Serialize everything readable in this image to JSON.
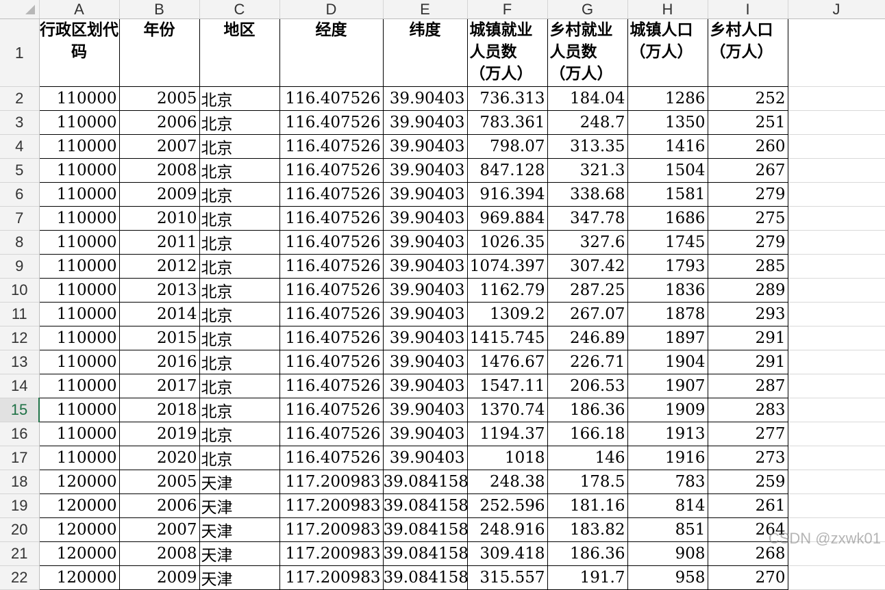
{
  "columns": [
    "A",
    "B",
    "C",
    "D",
    "E",
    "F",
    "G",
    "H",
    "I",
    "J"
  ],
  "header_row": {
    "row_number": "1",
    "cells": [
      "行政区划代码",
      "年份",
      "地区",
      "经度",
      "纬度",
      "城镇就业人员数（万人）",
      "乡村就业人员数（万人）",
      "城镇人口（万人）",
      "乡村人口（万人）",
      ""
    ]
  },
  "active_row": "15",
  "rows": [
    {
      "n": "2",
      "v": [
        "110000",
        "2005",
        "北京",
        "116.407526",
        "39.90403",
        "736.313",
        "184.04",
        "1286",
        "252"
      ]
    },
    {
      "n": "3",
      "v": [
        "110000",
        "2006",
        "北京",
        "116.407526",
        "39.90403",
        "783.361",
        "248.7",
        "1350",
        "251"
      ]
    },
    {
      "n": "4",
      "v": [
        "110000",
        "2007",
        "北京",
        "116.407526",
        "39.90403",
        "798.07",
        "313.35",
        "1416",
        "260"
      ]
    },
    {
      "n": "5",
      "v": [
        "110000",
        "2008",
        "北京",
        "116.407526",
        "39.90403",
        "847.128",
        "321.3",
        "1504",
        "267"
      ]
    },
    {
      "n": "6",
      "v": [
        "110000",
        "2009",
        "北京",
        "116.407526",
        "39.90403",
        "916.394",
        "338.68",
        "1581",
        "279"
      ]
    },
    {
      "n": "7",
      "v": [
        "110000",
        "2010",
        "北京",
        "116.407526",
        "39.90403",
        "969.884",
        "347.78",
        "1686",
        "275"
      ]
    },
    {
      "n": "8",
      "v": [
        "110000",
        "2011",
        "北京",
        "116.407526",
        "39.90403",
        "1026.35",
        "327.6",
        "1745",
        "279"
      ]
    },
    {
      "n": "9",
      "v": [
        "110000",
        "2012",
        "北京",
        "116.407526",
        "39.90403",
        "1074.397",
        "307.42",
        "1793",
        "285"
      ]
    },
    {
      "n": "10",
      "v": [
        "110000",
        "2013",
        "北京",
        "116.407526",
        "39.90403",
        "1162.79",
        "287.25",
        "1836",
        "289"
      ]
    },
    {
      "n": "11",
      "v": [
        "110000",
        "2014",
        "北京",
        "116.407526",
        "39.90403",
        "1309.2",
        "267.07",
        "1878",
        "293"
      ]
    },
    {
      "n": "12",
      "v": [
        "110000",
        "2015",
        "北京",
        "116.407526",
        "39.90403",
        "1415.745",
        "246.89",
        "1897",
        "291"
      ]
    },
    {
      "n": "13",
      "v": [
        "110000",
        "2016",
        "北京",
        "116.407526",
        "39.90403",
        "1476.67",
        "226.71",
        "1904",
        "291"
      ]
    },
    {
      "n": "14",
      "v": [
        "110000",
        "2017",
        "北京",
        "116.407526",
        "39.90403",
        "1547.11",
        "206.53",
        "1907",
        "287"
      ]
    },
    {
      "n": "15",
      "v": [
        "110000",
        "2018",
        "北京",
        "116.407526",
        "39.90403",
        "1370.74",
        "186.36",
        "1909",
        "283"
      ]
    },
    {
      "n": "16",
      "v": [
        "110000",
        "2019",
        "北京",
        "116.407526",
        "39.90403",
        "1194.37",
        "166.18",
        "1913",
        "277"
      ]
    },
    {
      "n": "17",
      "v": [
        "110000",
        "2020",
        "北京",
        "116.407526",
        "39.90403",
        "1018",
        "146",
        "1916",
        "273"
      ]
    },
    {
      "n": "18",
      "v": [
        "120000",
        "2005",
        "天津",
        "117.200983",
        "39.084158",
        "248.38",
        "178.5",
        "783",
        "259"
      ]
    },
    {
      "n": "19",
      "v": [
        "120000",
        "2006",
        "天津",
        "117.200983",
        "39.084158",
        "252.596",
        "181.16",
        "814",
        "261"
      ]
    },
    {
      "n": "20",
      "v": [
        "120000",
        "2007",
        "天津",
        "117.200983",
        "39.084158",
        "248.916",
        "183.82",
        "851",
        "264"
      ]
    },
    {
      "n": "21",
      "v": [
        "120000",
        "2008",
        "天津",
        "117.200983",
        "39.084158",
        "309.418",
        "186.36",
        "908",
        "268"
      ]
    },
    {
      "n": "22",
      "v": [
        "120000",
        "2009",
        "天津",
        "117.200983",
        "39.084158",
        "315.557",
        "191.7",
        "958",
        "270"
      ]
    }
  ],
  "watermark": "CSDN @zxwk01"
}
